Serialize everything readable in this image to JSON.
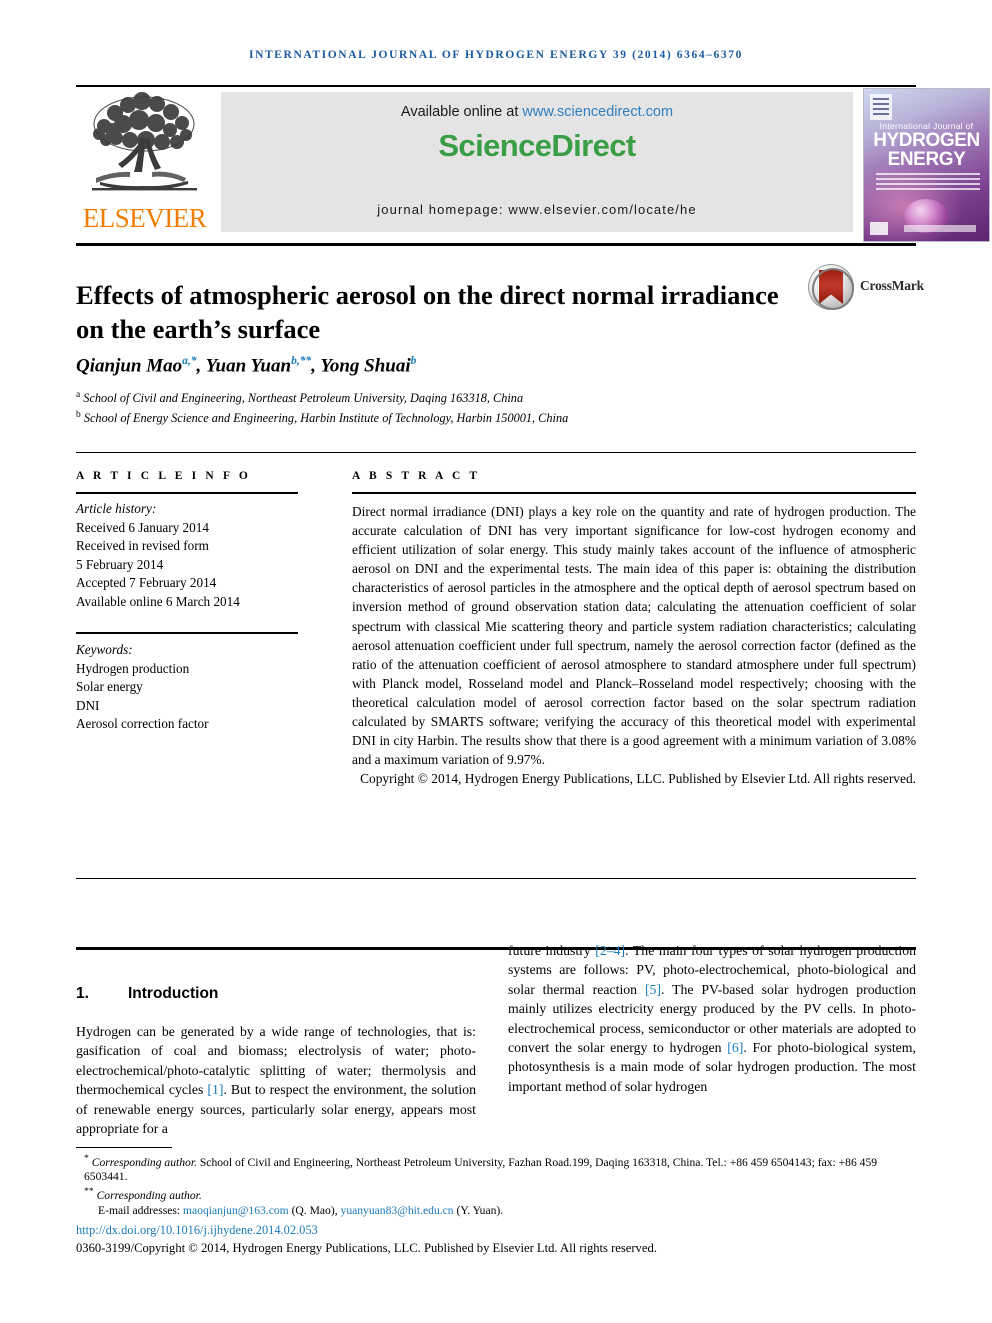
{
  "running_head": "International Journal of Hydrogen Energy 39 (2014) 6364–6370",
  "masthead": {
    "publisher_name": "ELSEVIER",
    "publisher_logo_icon": "elsevier-tree-icon",
    "available_online_prefix": "Available online at ",
    "sciencedirect_url": "www.sciencedirect.com",
    "sciencedirect_logo": "ScienceDirect",
    "journal_homepage": "journal homepage: www.elsevier.com/locate/he",
    "cover": {
      "small_title": "International Journal of",
      "big_title_line1": "HYDROGEN",
      "big_title_line2": "ENERGY",
      "publisher_mark_icon": "elsevier-mark-icon",
      "sphere_icon": "sphere-graphic-icon",
      "sd_mark_icon": "sciencedirect-mark-icon"
    }
  },
  "article": {
    "title": "Effects of atmospheric aerosol on the direct normal irradiance on the earth’s surface",
    "crossmark_label": "CrossMark",
    "crossmark_icon": "crossmark-logo-icon",
    "authors_html": "Qianjun Mao<sup>a,*</sup>, Yuan Yuan<sup>b,**</sup>, Yong Shuai<sup>b</sup>",
    "affiliations": [
      {
        "marker": "a",
        "text": "School of Civil and Engineering, Northeast Petroleum University, Daqing 163318, China"
      },
      {
        "marker": "b",
        "text": "School of Energy Science and Engineering, Harbin Institute of Technology, Harbin 150001, China"
      }
    ]
  },
  "article_info": {
    "heading": "A R T I C L E  I N F O",
    "history_label": "Article history:",
    "history": [
      "Received 6 January 2014",
      "Received in revised form",
      "5 February 2014",
      "Accepted 7 February 2014",
      "Available online 6 March 2014"
    ],
    "keywords_label": "Keywords:",
    "keywords": [
      "Hydrogen production",
      "Solar energy",
      "DNI",
      "Aerosol correction factor"
    ]
  },
  "abstract": {
    "heading": "A B S T R A C T",
    "body": "Direct normal irradiance (DNI) plays a key role on the quantity and rate of hydrogen production. The accurate calculation of DNI has very important significance for low-cost hydrogen economy and efficient utilization of solar energy. This study mainly takes account of the influence of atmospheric aerosol on DNI and the experimental tests. The main idea of this paper is: obtaining the distribution characteristics of aerosol particles in the atmosphere and the optical depth of aerosol spectrum based on inversion method of ground observation station data; calculating the attenuation coefficient of solar spectrum with classical Mie scattering theory and particle system radiation characteristics; calculating aerosol attenuation coefficient under full spectrum, namely the aerosol correction factor (defined as the ratio of the attenuation coefficient of aerosol atmosphere to standard atmosphere under full spectrum) with Planck model, Rosseland model and Planck–Rosseland model respectively; choosing with the theoretical calculation model of aerosol correction factor based on the solar spectrum radiation calculated by SMARTS software; verifying the accuracy of this theoretical model with experimental DNI in city Harbin. The results show that there is a good agreement with a minimum variation of 3.08% and a maximum variation of 9.97%.",
    "copyright": "Copyright © 2014, Hydrogen Energy Publications, LLC. Published by Elsevier Ltd. All rights reserved."
  },
  "section": {
    "number": "1.",
    "title": "Introduction",
    "left_column_html": "Hydrogen can be generated by a wide range of technologies, that is: gasification of coal and biomass; electrolysis of water; photo-electrochemical/photo-catalytic splitting of water; thermolysis and thermochemical cycles <span class=\"ref\">[1]</span>. But to respect the environment, the solution of renewable energy sources, particularly solar energy, appears most appropriate for a",
    "right_column_html": "future industry <span class=\"ref\">[2–4]</span>. The main four types of solar hydrogen production systems are follows: PV, photo-electrochemical, photo-biological and solar thermal reaction <span class=\"ref\">[5]</span>. The PV-based solar hydrogen production mainly utilizes electricity energy produced by the PV cells. In photo-electrochemical process, semiconductor or other materials are adopted to convert the solar energy to hydrogen <span class=\"ref\">[6]</span>. For photo-biological system, photosynthesis is a main mode of solar hydrogen production. The most important method of solar hydrogen"
  },
  "footnotes": {
    "corresponding_1_html": "<sup>*</sup> <span class=\"fn-it\">Corresponding author.</span> School of Civil and Engineering, Northeast Petroleum University, Fazhan Road.199, Daqing 163318, China. Tel.: +86 459 6504143; fax: +86 459 6503441.",
    "corresponding_2_html": "<sup>**</sup> <span class=\"fn-it\">Corresponding author.</span>",
    "emails_html": "E-mail addresses: <span class=\"lnk\">maoqianjun@163.com</span> (Q. Mao), <span class=\"lnk\">yuanyuan83@hit.edu.cn</span> (Y. Yuan).",
    "doi": "http://dx.doi.org/10.1016/j.ijhydene.2014.02.053",
    "issn_line": "0360-3199/Copyright © 2014, Hydrogen Energy Publications, LLC. Published by Elsevier Ltd. All rights reserved."
  },
  "colors": {
    "running_head_blue": "#1a5a9e",
    "sciencedirect_green": "#3a9e46",
    "link_blue": "#1a7bb9",
    "elsevier_orange": "#F07D00",
    "banner_gray": "#e4e4e4"
  }
}
